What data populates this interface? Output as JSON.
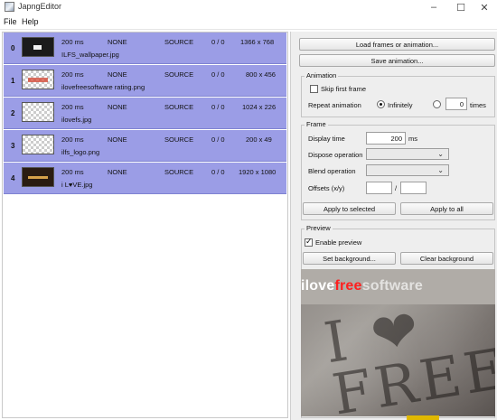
{
  "window": {
    "title": "JapngEditor",
    "controls": [
      "–",
      "☐",
      "✕"
    ]
  },
  "menu": [
    "File",
    "Help"
  ],
  "frames": [
    {
      "index": "0",
      "delay": "200 ms",
      "dispose": "NONE",
      "blend": "SOURCE",
      "offset": "0 / 0",
      "size": "1366 x 768",
      "name": "ILFS_wallpaper.jpg",
      "thumb": "dark"
    },
    {
      "index": "1",
      "delay": "200 ms",
      "dispose": "NONE",
      "blend": "SOURCE",
      "offset": "0 / 0",
      "size": "800 x 456",
      "name": "ilovefreesoftware rating.png",
      "thumb": "light-red"
    },
    {
      "index": "2",
      "delay": "200 ms",
      "dispose": "NONE",
      "blend": "SOURCE",
      "offset": "0 / 0",
      "size": "1024 x 226",
      "name": "ilovefs.jpg",
      "thumb": "checker"
    },
    {
      "index": "3",
      "delay": "200 ms",
      "dispose": "NONE",
      "blend": "SOURCE",
      "offset": "0 / 0",
      "size": "200 x 49",
      "name": "ilfs_logo.png",
      "thumb": "checker"
    },
    {
      "index": "4",
      "delay": "200 ms",
      "dispose": "NONE",
      "blend": "SOURCE",
      "offset": "0 / 0",
      "size": "1920 x 1080",
      "name": "i L♥VE.jpg",
      "thumb": "brown"
    }
  ],
  "actions": {
    "load": "Load frames or animation...",
    "save": "Save animation..."
  },
  "animation": {
    "section": "Animation",
    "skip_first_frame": "Skip first frame",
    "skip_checked": false,
    "repeat_label": "Repeat animation",
    "infinitely": "Infinitely",
    "times_value": "0",
    "times_label": "times",
    "mode": "infinitely"
  },
  "frame_settings": {
    "section": "Frame",
    "display_time_label": "Display time",
    "display_time_value": "200",
    "display_time_unit": "ms",
    "dispose_label": "Dispose operation",
    "dispose_value": "",
    "blend_label": "Blend operation",
    "blend_value": "",
    "offsets_label": "Offsets (x/y)",
    "offset_x": "",
    "offset_sep": "/",
    "offset_y": "",
    "apply_selected": "Apply to selected",
    "apply_all": "Apply to all"
  },
  "preview": {
    "section": "Preview",
    "enable_label": "Enable preview",
    "enable_checked": true,
    "set_background": "Set background...",
    "clear_background": "Clear background",
    "logo_part1": "ilove",
    "logo_part2": "free",
    "logo_part3": "software",
    "sand_text": "I ❤\nFREE"
  }
}
